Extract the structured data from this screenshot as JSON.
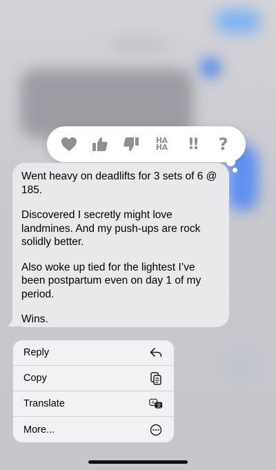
{
  "reactions": [
    {
      "name": "heart",
      "icon": "heart-icon"
    },
    {
      "name": "thumbs-up",
      "icon": "thumbs-up-icon"
    },
    {
      "name": "thumbs-down",
      "icon": "thumbs-down-icon"
    },
    {
      "name": "haha",
      "label_top": "HA",
      "label_bottom": "HA"
    },
    {
      "name": "emphasize",
      "label": "!!"
    },
    {
      "name": "question",
      "label": "?"
    }
  ],
  "message": {
    "paragraphs": [
      "Went heavy on deadlifts for 3 sets of 6 @ 185.",
      "Discovered I secretly might love landmines. And my push-ups are rock solidly better.",
      "Also woke up tied for the lightest I’ve been postpartum even on day 1 of my period.",
      "Wins."
    ]
  },
  "menu": {
    "items": [
      {
        "label": "Reply",
        "icon": "reply-icon"
      },
      {
        "label": "Copy",
        "icon": "copy-icon"
      },
      {
        "label": "Translate",
        "icon": "translate-icon"
      },
      {
        "label": "More...",
        "icon": "more-icon"
      }
    ]
  },
  "colors": {
    "bubble": "#e9e9eb",
    "reaction_gray": "#8e8e93",
    "menu_bg": "#f2f2f4"
  }
}
